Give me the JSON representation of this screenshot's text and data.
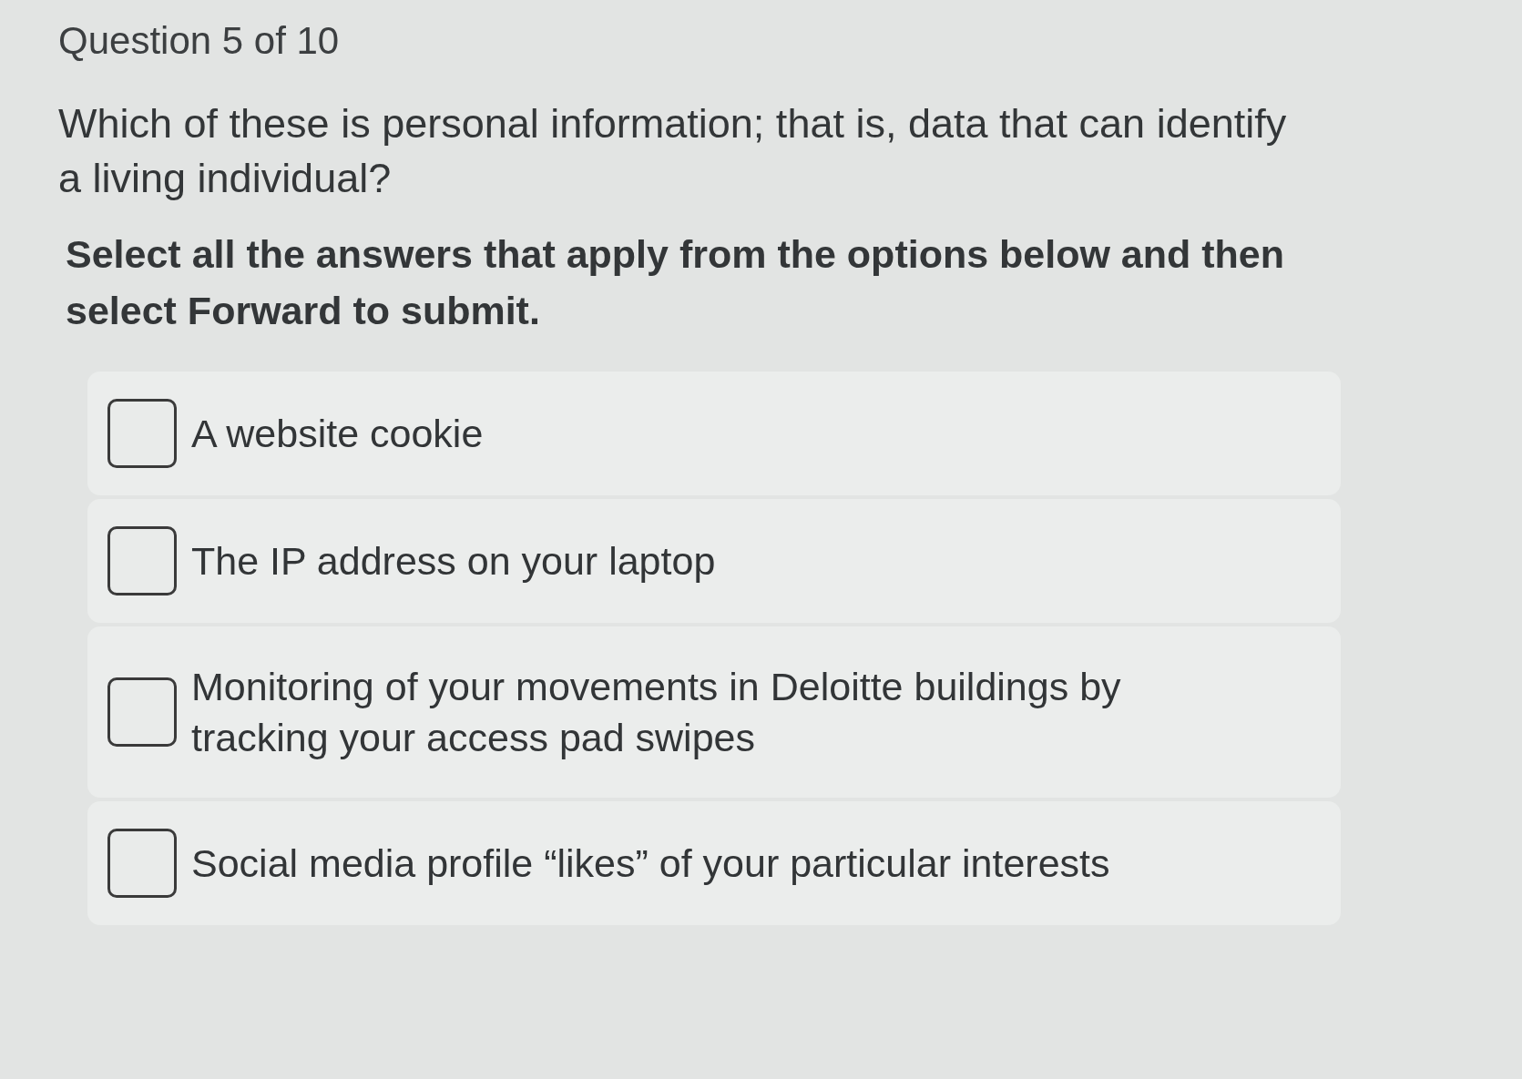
{
  "header": {
    "progress": "Question 5 of 10"
  },
  "question": {
    "text": "Which of these is personal information; that is, data that can identify a living individual?",
    "instruction": "Select all the answers that apply from the options below and then select Forward to submit."
  },
  "options": [
    {
      "label": "A website cookie",
      "checked": false
    },
    {
      "label": "The IP address on your laptop",
      "checked": false
    },
    {
      "label": "Monitoring of your movements in Deloitte buildings by tracking your access pad swipes",
      "checked": false
    },
    {
      "label": "Social media profile “likes” of your particular interests",
      "checked": false
    }
  ]
}
